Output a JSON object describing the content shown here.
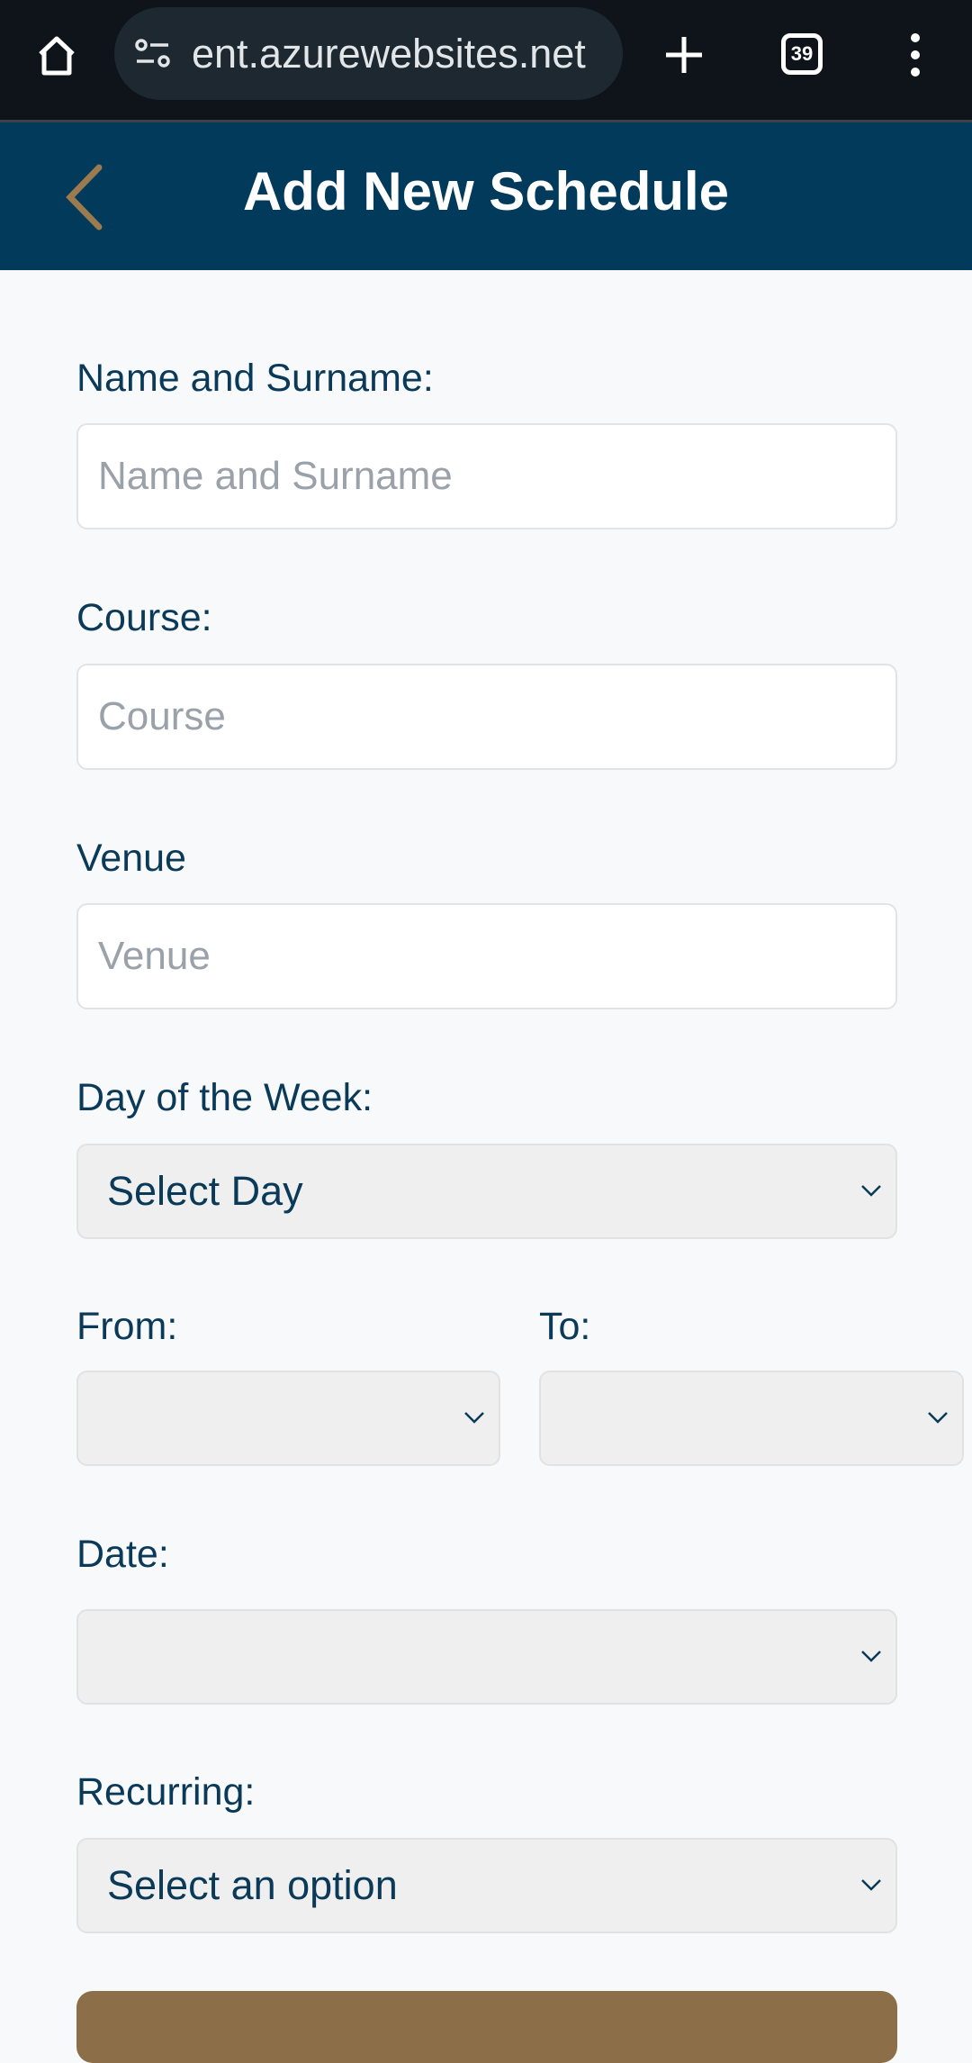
{
  "browser": {
    "url": "ent.azurewebsites.net",
    "tab_count": "39"
  },
  "header": {
    "title": "Add New Schedule"
  },
  "form": {
    "name": {
      "label": "Name and Surname:",
      "placeholder": "Name and Surname"
    },
    "course": {
      "label": "Course:",
      "placeholder": "Course"
    },
    "venue": {
      "label": "Venue",
      "placeholder": "Venue"
    },
    "day": {
      "label": "Day of the Week:",
      "value": "Select Day"
    },
    "from": {
      "label": "From:",
      "value": ""
    },
    "to": {
      "label": "To:",
      "value": ""
    },
    "date": {
      "label": "Date:",
      "value": ""
    },
    "recurring": {
      "label": "Recurring:",
      "value": "Select an option"
    }
  },
  "colors": {
    "header": "#013a5a",
    "accent": "#8c6f48",
    "text": "#0b3a59"
  }
}
